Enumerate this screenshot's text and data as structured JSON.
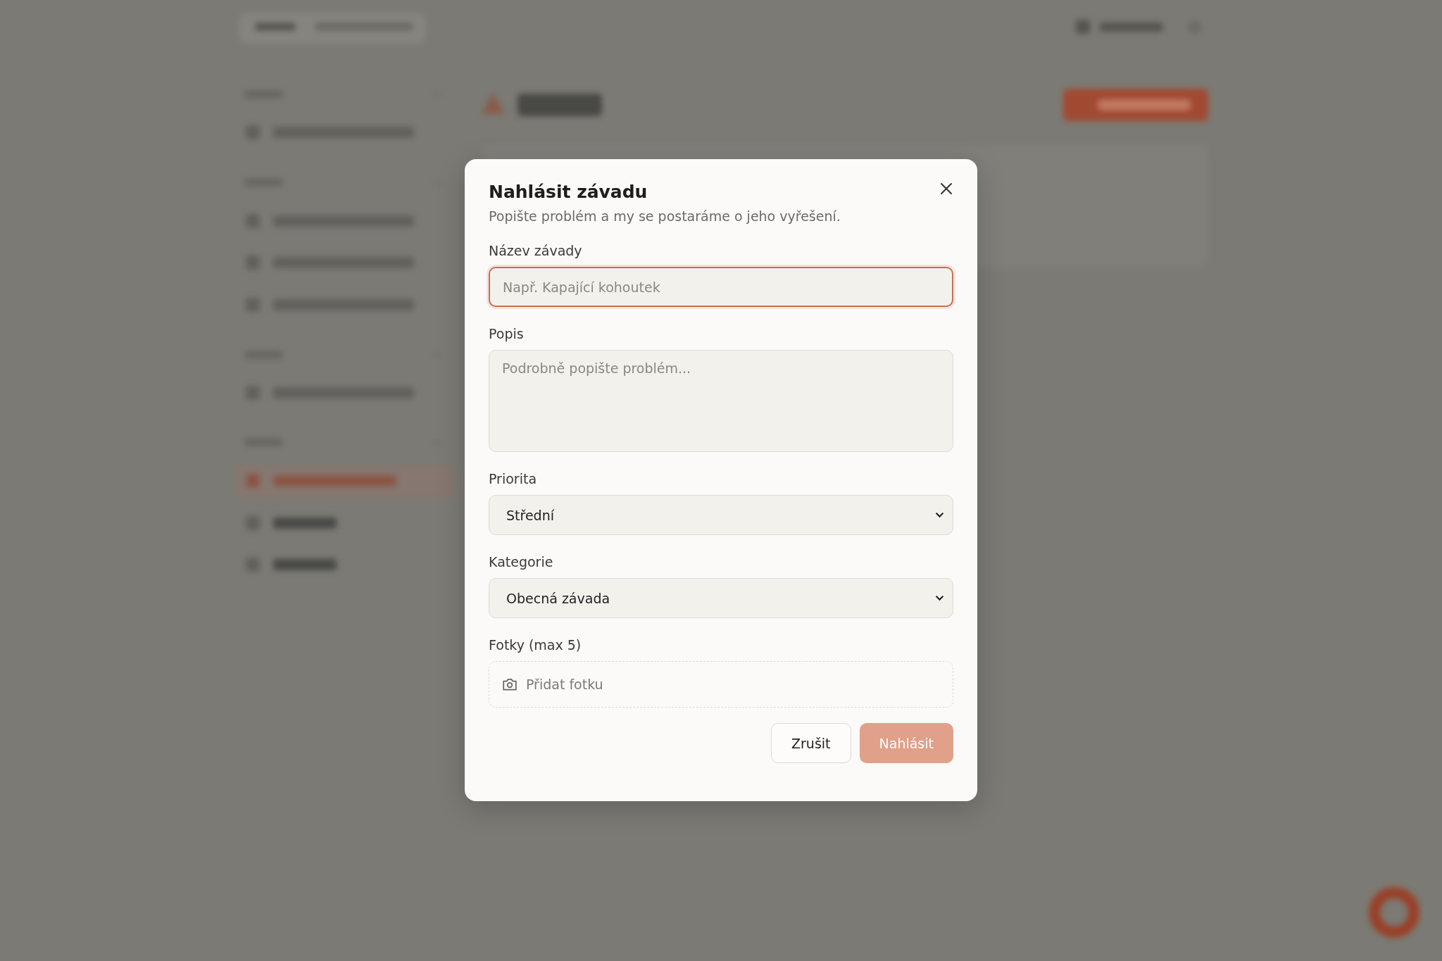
{
  "dialog": {
    "title": "Nahlásit závadu",
    "subtitle": "Popište problém a my se postaráme o jeho vyřešení.",
    "fields": [
      {
        "kind": "input",
        "label": "Název závady",
        "placeholder": "Např. Kapající kohoutek",
        "focused": true
      },
      {
        "kind": "textarea",
        "label": "Popis",
        "placeholder": "Podrobně popište problém..."
      },
      {
        "kind": "select",
        "label": "Priorita",
        "value": "Střední"
      },
      {
        "kind": "select",
        "label": "Kategorie",
        "value": "Obecná závada"
      },
      {
        "kind": "upload",
        "label": "Fotky (max 5)",
        "button": "Přidat fotku"
      }
    ],
    "buttons": [
      {
        "kind": "secondary",
        "label": "Zrušit",
        "disabled": false
      },
      {
        "kind": "primary",
        "label": "Nahlásit",
        "disabled": true
      }
    ]
  }
}
